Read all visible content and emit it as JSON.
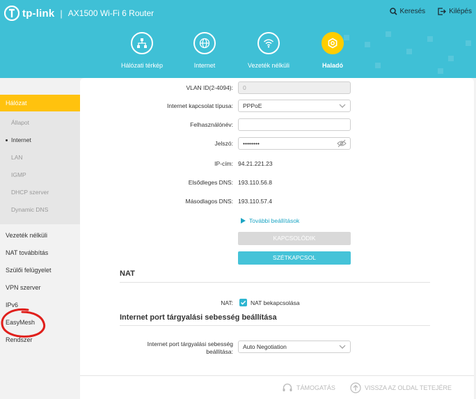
{
  "header": {
    "brand": "tp-link",
    "model": "AX1500 Wi-Fi 6 Router",
    "search_label": "Keresés",
    "logout_label": "Kilépés"
  },
  "nav": {
    "items": [
      {
        "label": "Hálózati térkép",
        "icon": "network-map-icon"
      },
      {
        "label": "Internet",
        "icon": "globe-icon"
      },
      {
        "label": "Vezeték nélküli",
        "icon": "wifi-icon"
      },
      {
        "label": "Haladó",
        "icon": "advanced-gear-icon",
        "active": true
      }
    ]
  },
  "sidebar": {
    "section": "Hálózat",
    "sub_items": [
      "Állapot",
      "Internet",
      "LAN",
      "IGMP",
      "DHCP szerver",
      "Dynamic DNS"
    ],
    "active_sub": "Internet",
    "items": [
      "Vezeték nélküli",
      "NAT továbbítás",
      "Szülői felügyelet",
      "VPN szerver",
      "IPv6",
      "EasyMesh",
      "Rendszer"
    ]
  },
  "form": {
    "vlan_label": "VLAN ID(2-4094):",
    "vlan_value": "0",
    "conn_type_label": "Internet kapcsolat típusa:",
    "conn_type_value": "PPPoE",
    "username_label": "Felhasználónév:",
    "username_value": "",
    "password_label": "Jelszó:",
    "password_value": "••••••••",
    "ip_label": "IP-cím:",
    "ip_value": "94.21.221.23",
    "dns1_label": "Elsődleges DNS:",
    "dns1_value": "193.110.56.8",
    "dns2_label": "Másodlagos DNS:",
    "dns2_value": "193.110.57.4",
    "advanced_label": "További beállítások",
    "connect_label": "KAPCSOLÓDIK",
    "disconnect_label": "SZÉTKAPCSOL"
  },
  "nat": {
    "title": "NAT",
    "label": "NAT:",
    "checkbox_label": "NAT bekapcsolása",
    "checked": true
  },
  "speed": {
    "title": "Internet port tárgyalási sebesség beállítása",
    "label_line1": "Internet port tárgyalási sebesség",
    "label_line2": "beállítása:",
    "value": "Auto Negotiation"
  },
  "footer": {
    "support_label": "TÁMOGATÁS",
    "top_label": "VISSZA AZ OLDAL TETEJÉRE"
  },
  "colors": {
    "header": "#3fc0d6",
    "accent_yellow": "#ffc20e",
    "button_teal": "#45c3d8",
    "annotation_red": "#e0201c"
  }
}
